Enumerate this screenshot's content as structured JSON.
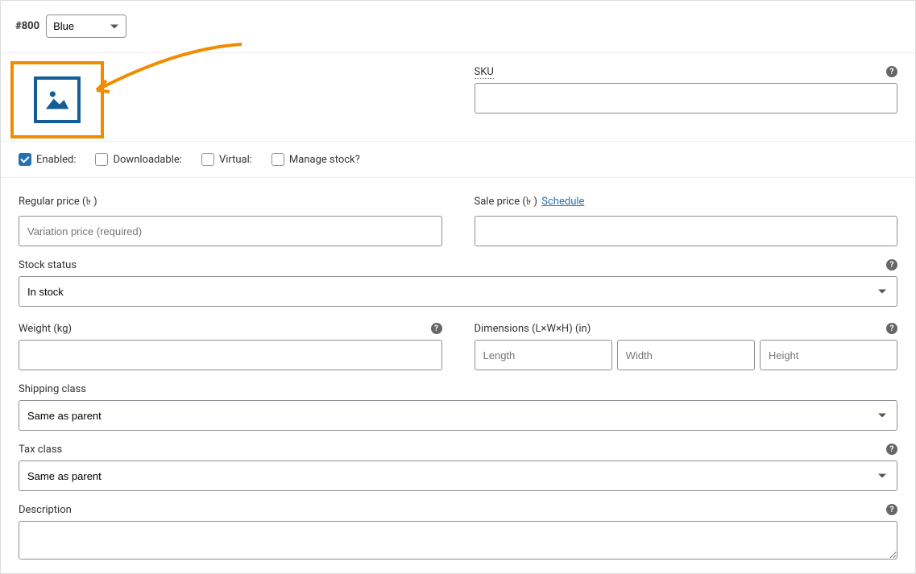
{
  "header": {
    "variation_id": "#800",
    "attribute_selected": "Blue"
  },
  "sku": {
    "label": "SKU"
  },
  "checkboxes": {
    "enabled": {
      "label": "Enabled:",
      "checked": true
    },
    "downloadable": {
      "label": "Downloadable:",
      "checked": false
    },
    "virtual": {
      "label": "Virtual:",
      "checked": false
    },
    "manage_stock": {
      "label": "Manage stock?",
      "checked": false
    }
  },
  "price": {
    "regular_label": "Regular price (৳ )",
    "regular_placeholder": "Variation price (required)",
    "sale_label": "Sale price (৳ )",
    "schedule_link": "Schedule"
  },
  "stock": {
    "label": "Stock status",
    "value": "In stock"
  },
  "weight": {
    "label": "Weight (kg)"
  },
  "dimensions": {
    "label": "Dimensions (L×W×H) (in)",
    "length_placeholder": "Length",
    "width_placeholder": "Width",
    "height_placeholder": "Height"
  },
  "shipping": {
    "label": "Shipping class",
    "value": "Same as parent"
  },
  "tax": {
    "label": "Tax class",
    "value": "Same as parent"
  },
  "description": {
    "label": "Description"
  }
}
